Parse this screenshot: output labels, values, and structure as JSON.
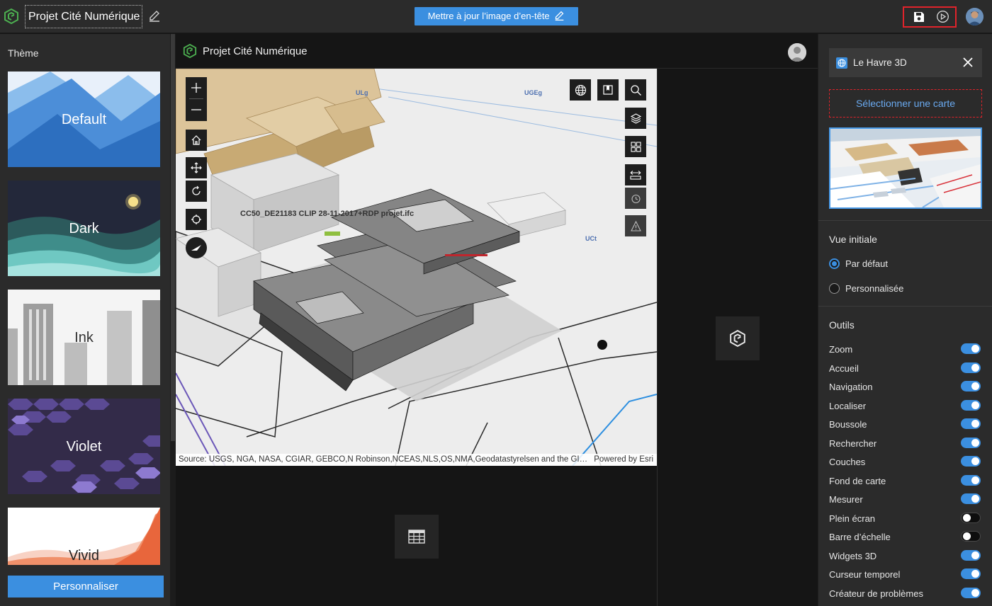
{
  "topbar": {
    "title": "Projet Cité Numérique",
    "header_button_label": "Mettre à jour l’image d’en-tête"
  },
  "left_panel": {
    "heading": "Thème",
    "themes": [
      "Default",
      "Dark",
      "Ink",
      "Violet",
      "Vivid"
    ],
    "customize_label": "Personnaliser"
  },
  "preview": {
    "title": "Projet Cité Numérique",
    "map_label": "CC50_DE21183 CLIP 28-11-2017+RDP projet.ifc",
    "zone_labels": [
      "ULg",
      "UGEg",
      "UCt"
    ],
    "attribution": "Source: USGS, NGA, NASA, CGIAR, GEBCO,N Robinson,NCEAS,NLS,OS,NMA,Geodatastyrelsen and the GI…",
    "powered_by": "Powered by Esri"
  },
  "right_panel": {
    "webscene_name": "Le Havre 3D",
    "select_map_label": "Sélectionner une carte",
    "initial_view_heading": "Vue initiale",
    "initial_view_options": [
      {
        "label": "Par défaut",
        "selected": true
      },
      {
        "label": "Personnalisée",
        "selected": false
      }
    ],
    "tools_heading": "Outils",
    "tools": [
      {
        "label": "Zoom",
        "enabled": true
      },
      {
        "label": "Accueil",
        "enabled": true
      },
      {
        "label": "Navigation",
        "enabled": true
      },
      {
        "label": "Localiser",
        "enabled": true
      },
      {
        "label": "Boussole",
        "enabled": true
      },
      {
        "label": "Rechercher",
        "enabled": true
      },
      {
        "label": "Couches",
        "enabled": true
      },
      {
        "label": "Fond de carte",
        "enabled": true
      },
      {
        "label": "Mesurer",
        "enabled": true
      },
      {
        "label": "Plein écran",
        "enabled": false
      },
      {
        "label": "Barre d’échelle",
        "enabled": false
      },
      {
        "label": "Widgets 3D",
        "enabled": true
      },
      {
        "label": "Curseur temporel",
        "enabled": true
      },
      {
        "label": "Créateur de problèmes",
        "enabled": true
      }
    ]
  },
  "colors": {
    "accent": "#3b8fe0",
    "highlight_border": "#e0232b",
    "logo_green": "#4caf50"
  },
  "icons": [
    "logo-icon",
    "edit-icon",
    "save-icon",
    "play-icon",
    "globe-icon",
    "bookmark-icon",
    "search-icon",
    "layers-icon",
    "basemap-icon",
    "measure-icon",
    "daylight-icon",
    "slice-icon",
    "zoom-in-icon",
    "zoom-out-icon",
    "home-icon",
    "pan-icon",
    "rotate-icon",
    "locate-icon",
    "compass-icon",
    "table-icon",
    "close-icon"
  ]
}
